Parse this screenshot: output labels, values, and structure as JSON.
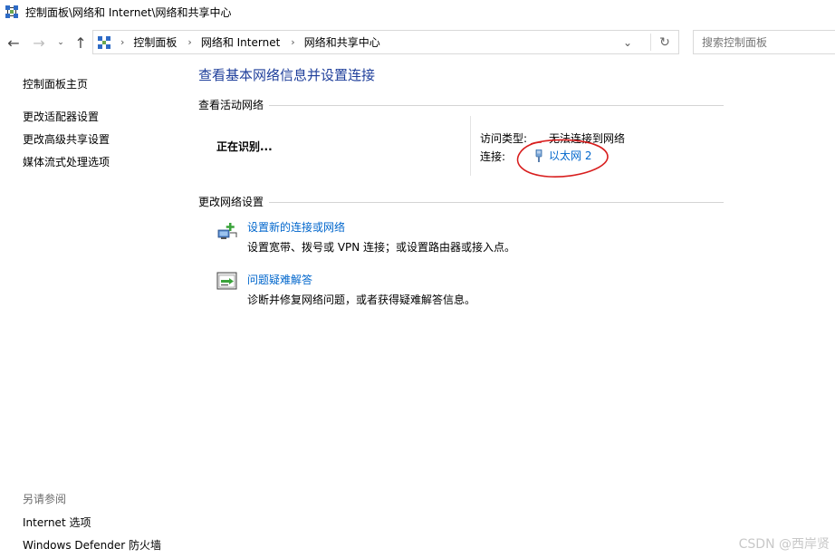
{
  "window": {
    "title": "控制面板\\网络和 Internet\\网络和共享中心"
  },
  "address_bar": {
    "breadcrumbs": [
      "控制面板",
      "网络和 Internet",
      "网络和共享中心"
    ],
    "search_placeholder": "搜索控制面板"
  },
  "left_nav": {
    "home": "控制面板主页",
    "items": [
      "更改适配器设置",
      "更改高级共享设置",
      "媒体流式处理选项"
    ]
  },
  "see_also": {
    "title": "另请参阅",
    "items": [
      "Internet 选项",
      "Windows Defender 防火墙"
    ]
  },
  "main": {
    "title": "查看基本网络信息并设置连接",
    "active_networks": {
      "header": "查看活动网络",
      "network_name": "正在识别...",
      "access_type_label": "访问类型:",
      "access_type_value": "无法连接到网络",
      "connection_label": "连接:",
      "connection_value": "以太网 2"
    },
    "change_settings": {
      "header": "更改网络设置",
      "tasks": [
        {
          "link": "设置新的连接或网络",
          "description": "设置宽带、拨号或 VPN 连接；或设置路由器或接入点。",
          "icon": "network-setup-icon"
        },
        {
          "link": "问题疑难解答",
          "description": "诊断并修复网络问题，或者获得疑难解答信息。",
          "icon": "troubleshoot-icon"
        }
      ]
    }
  },
  "watermark": "CSDN @西岸贤",
  "colors": {
    "link": "#0066cc",
    "title": "#1f3f9b",
    "annotation": "#d81e1e"
  }
}
